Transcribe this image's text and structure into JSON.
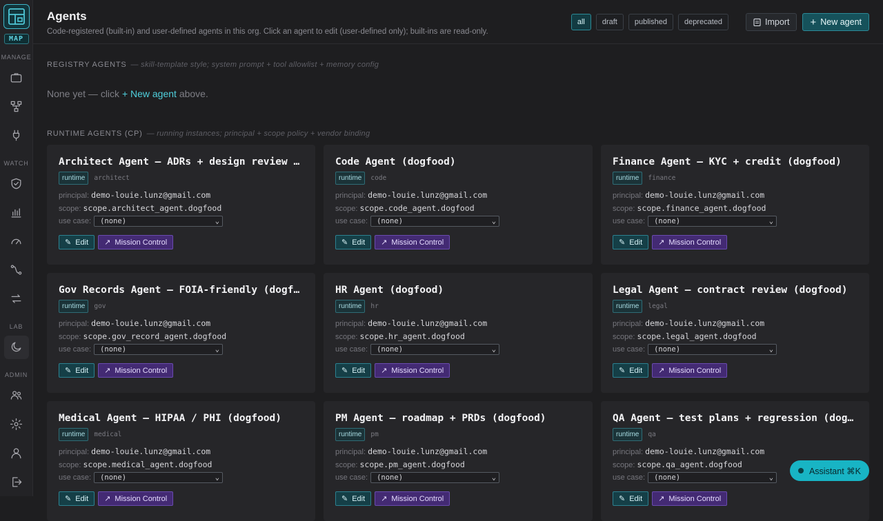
{
  "sidebar": {
    "logo_text": "MAP",
    "sections": {
      "manage": "MANAGE",
      "watch": "WATCH",
      "lab": "LAB",
      "admin": "ADMIN"
    },
    "manage_icons": [
      "briefcase-icon",
      "hierarchy-icon",
      "plug-icon"
    ],
    "watch_icons": [
      "shield-check-icon",
      "bar-chart-icon",
      "gauge-icon",
      "route-icon",
      "swap-icon"
    ],
    "lab_icons": [
      "moon-icon"
    ],
    "admin_icons": [
      "users-icon",
      "gear-icon",
      "user-icon",
      "logout-icon"
    ]
  },
  "header": {
    "title": "Agents",
    "subtitle": "Code-registered (built-in) and user-defined agents in this org. Click an agent to edit (user-defined only); built-ins are read-only.",
    "filters": [
      "all",
      "draft",
      "published",
      "deprecated"
    ],
    "active_filter": "all",
    "import_label": "Import",
    "new_agent_label": "New agent"
  },
  "registry": {
    "title": "REGISTRY AGENTS",
    "note": "— skill-template style; system prompt + tool allowlist + memory config",
    "empty_prefix": "None yet — click",
    "empty_link": "+ New agent",
    "empty_suffix": "above."
  },
  "runtime": {
    "title": "RUNTIME AGENTS (CP)",
    "note": "— running instances; principal + scope policy + vendor binding",
    "labels": {
      "principal": "principal:",
      "scope": "scope:",
      "use_case": "use case:",
      "edit": "Edit",
      "mission_control": "Mission Control"
    },
    "agents": [
      {
        "name": "Architect Agent — ADRs + design review (dogfood)",
        "badge": "runtime",
        "kind": "architect",
        "principal": "demo-louie.lunz@gmail.com",
        "scope": "scope.architect_agent.dogfood",
        "use_case": "(none)"
      },
      {
        "name": "Code Agent (dogfood)",
        "badge": "runtime",
        "kind": "code",
        "principal": "demo-louie.lunz@gmail.com",
        "scope": "scope.code_agent.dogfood",
        "use_case": "(none)"
      },
      {
        "name": "Finance Agent — KYC + credit (dogfood)",
        "badge": "runtime",
        "kind": "finance",
        "principal": "demo-louie.lunz@gmail.com",
        "scope": "scope.finance_agent.dogfood",
        "use_case": "(none)"
      },
      {
        "name": "Gov Records Agent — FOIA-friendly (dogfood)",
        "badge": "runtime",
        "kind": "gov",
        "principal": "demo-louie.lunz@gmail.com",
        "scope": "scope.gov_record_agent.dogfood",
        "use_case": "(none)"
      },
      {
        "name": "HR Agent (dogfood)",
        "badge": "runtime",
        "kind": "hr",
        "principal": "demo-louie.lunz@gmail.com",
        "scope": "scope.hr_agent.dogfood",
        "use_case": "(none)"
      },
      {
        "name": "Legal Agent — contract review (dogfood)",
        "badge": "runtime",
        "kind": "legal",
        "principal": "demo-louie.lunz@gmail.com",
        "scope": "scope.legal_agent.dogfood",
        "use_case": "(none)"
      },
      {
        "name": "Medical Agent — HIPAA / PHI (dogfood)",
        "badge": "runtime",
        "kind": "medical",
        "principal": "demo-louie.lunz@gmail.com",
        "scope": "scope.medical_agent.dogfood",
        "use_case": "(none)"
      },
      {
        "name": "PM Agent — roadmap + PRDs (dogfood)",
        "badge": "runtime",
        "kind": "pm",
        "principal": "demo-louie.lunz@gmail.com",
        "scope": "scope.pm_agent.dogfood",
        "use_case": "(none)"
      },
      {
        "name": "QA Agent — test plans + regression (dogfood)",
        "badge": "runtime",
        "kind": "qa",
        "principal": "demo-louie.lunz@gmail.com",
        "scope": "scope.qa_agent.dogfood",
        "use_case": "(none)"
      }
    ]
  },
  "assistant": {
    "label": "Assistant ⌘K"
  },
  "colors": {
    "accent": "#18b4c4",
    "mission_control": "#432a73",
    "background": "#1e1e20"
  }
}
